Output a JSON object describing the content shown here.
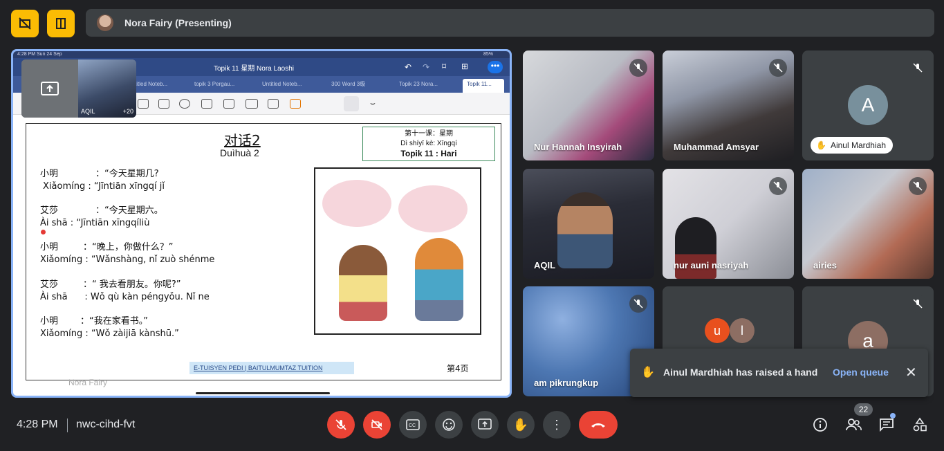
{
  "top_bar": {
    "presenter_label": "Nora Fairy (Presenting)"
  },
  "presentation": {
    "status_time": "4:28 PM   Sun 24 Sep",
    "battery": "85%",
    "doc_title": "Topik 11 星期 Nora Laoshi",
    "tabs": [
      "titled Noteb...",
      "topik 3 Pergau...",
      "Untitled Noteb...",
      "300 Word 3级",
      "Topik 23 Nora...",
      "Topik 11..."
    ],
    "pip": {
      "name": "AQIL",
      "count": "+20"
    },
    "presenter_overlay": "Nora Fairy",
    "page": {
      "title_zh": "对话2",
      "title_py": "Duìhuà 2",
      "box_line1": "第十一课：星期",
      "box_line2": "Dì shíyī kè: Xīngqí",
      "box_line3": "Topik 11 : Hari",
      "lines": [
        {
          "zh_speaker": "小明",
          "zh_text": "：“今天星期几?",
          "py": "Xiǎomíng : “Jīntiān xīngqí jǐ"
        },
        {
          "zh_speaker": "艾莎",
          "zh_text": "：“今天星期六。",
          "py": "Ài shā : “Jīntiān xīngqíliù"
        },
        {
          "zh_speaker": "小明",
          "zh_text": "：“晚上，你做什么？”",
          "py": "Xiǎomíng : “Wǎnshàng, nǐ zuò shénme"
        },
        {
          "zh_speaker": "艾莎",
          "zh_text": "：“ 我去看朋友。你呢?”",
          "py": "Ài shā      : Wǒ qù kàn péngyǒu. Nǐ ne"
        },
        {
          "zh_speaker": "小明",
          "zh_text": "：“我在家看书。”",
          "py": "Xiǎomíng : “Wǒ zàijiā kànshū.”"
        }
      ],
      "footer_tag": "E-TUISYEN PEDI | BAITULMUMTAZ TUITION",
      "page_number": "第4页"
    }
  },
  "participants": [
    {
      "name": "Nur Hannah Insyirah",
      "muted": true
    },
    {
      "name": "Muhammad Amsyar",
      "muted": true
    },
    {
      "name": "Ainul Mardhiah",
      "initial": "A",
      "muted": true,
      "hand_raised": true
    },
    {
      "name": "AQIL",
      "muted": false
    },
    {
      "name": "nur auni nasriyah",
      "muted": true
    },
    {
      "name": "airies",
      "muted": true
    },
    {
      "name": "am pikrungkup",
      "muted": true
    },
    {
      "initials": [
        "u",
        "l"
      ]
    },
    {
      "initial": "a",
      "muted": true
    }
  ],
  "toast": {
    "message": "Ainul Mardhiah has raised a hand",
    "action": "Open queue"
  },
  "bottom_bar": {
    "time": "4:28 PM",
    "meeting_code": "nwc-cihd-fvt",
    "people_count": "22"
  },
  "colors": {
    "background": "#202124",
    "accent_yellow": "#fbbc04",
    "danger_red": "#ea4335",
    "link_blue": "#8ab4f8"
  }
}
